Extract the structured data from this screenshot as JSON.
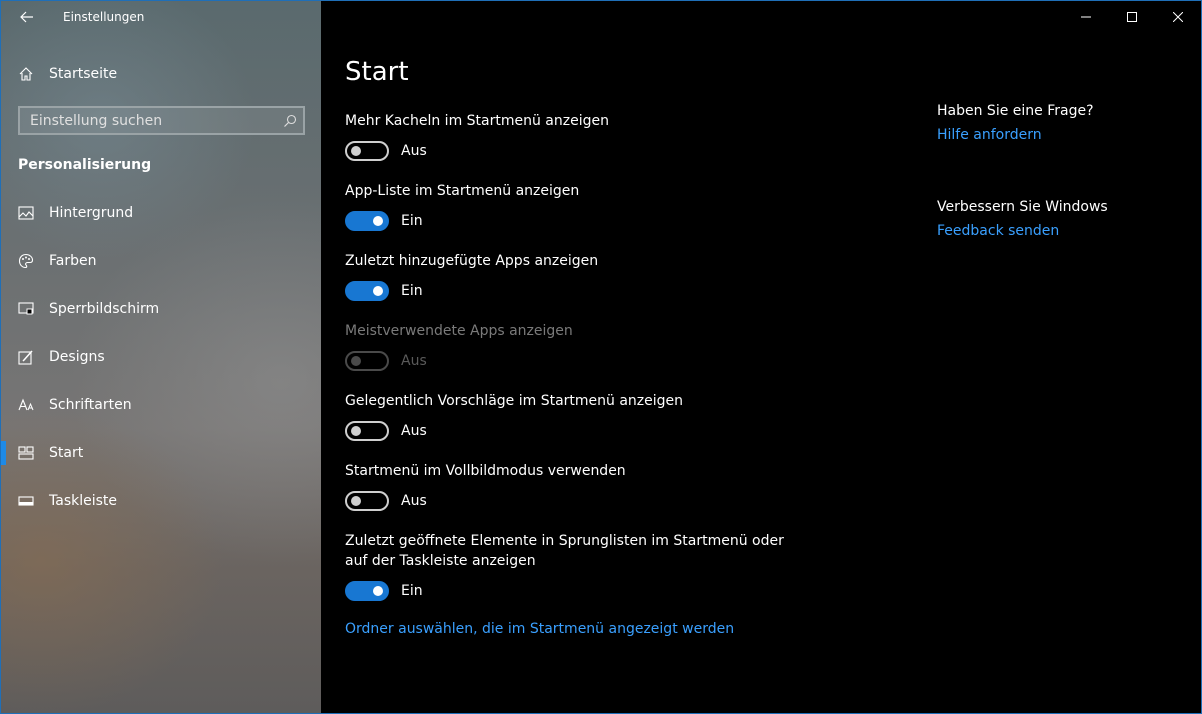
{
  "window": {
    "title": "Einstellungen"
  },
  "sidebar": {
    "home_label": "Startseite",
    "search_placeholder": "Einstellung suchen",
    "section_title": "Personalisierung",
    "items": [
      {
        "label": "Hintergrund",
        "icon": "picture-icon"
      },
      {
        "label": "Farben",
        "icon": "palette-icon"
      },
      {
        "label": "Sperrbildschirm",
        "icon": "lockscreen-icon"
      },
      {
        "label": "Designs",
        "icon": "brush-icon"
      },
      {
        "label": "Schriftarten",
        "icon": "font-icon"
      },
      {
        "label": "Start",
        "icon": "start-tiles-icon",
        "active": true
      },
      {
        "label": "Taskleiste",
        "icon": "taskbar-icon"
      }
    ]
  },
  "main": {
    "title": "Start",
    "settings": [
      {
        "label": "Mehr Kacheln im Startmenü anzeigen",
        "state": "Aus",
        "on": false,
        "disabled": false
      },
      {
        "label": "App-Liste im Startmenü anzeigen",
        "state": "Ein",
        "on": true,
        "disabled": false
      },
      {
        "label": "Zuletzt hinzugefügte Apps anzeigen",
        "state": "Ein",
        "on": true,
        "disabled": false
      },
      {
        "label": "Meistverwendete Apps anzeigen",
        "state": "Aus",
        "on": false,
        "disabled": true
      },
      {
        "label": "Gelegentlich Vorschläge im Startmenü anzeigen",
        "state": "Aus",
        "on": false,
        "disabled": false
      },
      {
        "label": "Startmenü im Vollbildmodus verwenden",
        "state": "Aus",
        "on": false,
        "disabled": false
      },
      {
        "label": "Zuletzt geöffnete Elemente in Sprunglisten im Startmenü oder auf der Taskleiste anzeigen",
        "state": "Ein",
        "on": true,
        "disabled": false
      }
    ],
    "folder_link": "Ordner auswählen, die im Startmenü angezeigt werden"
  },
  "help": {
    "question_heading": "Haben Sie eine Frage?",
    "question_link": "Hilfe anfordern",
    "improve_heading": "Verbessern Sie Windows",
    "improve_link": "Feedback senden"
  },
  "colors": {
    "accent": "#1877d2",
    "link": "#3aa0ff",
    "background": "#000000"
  }
}
